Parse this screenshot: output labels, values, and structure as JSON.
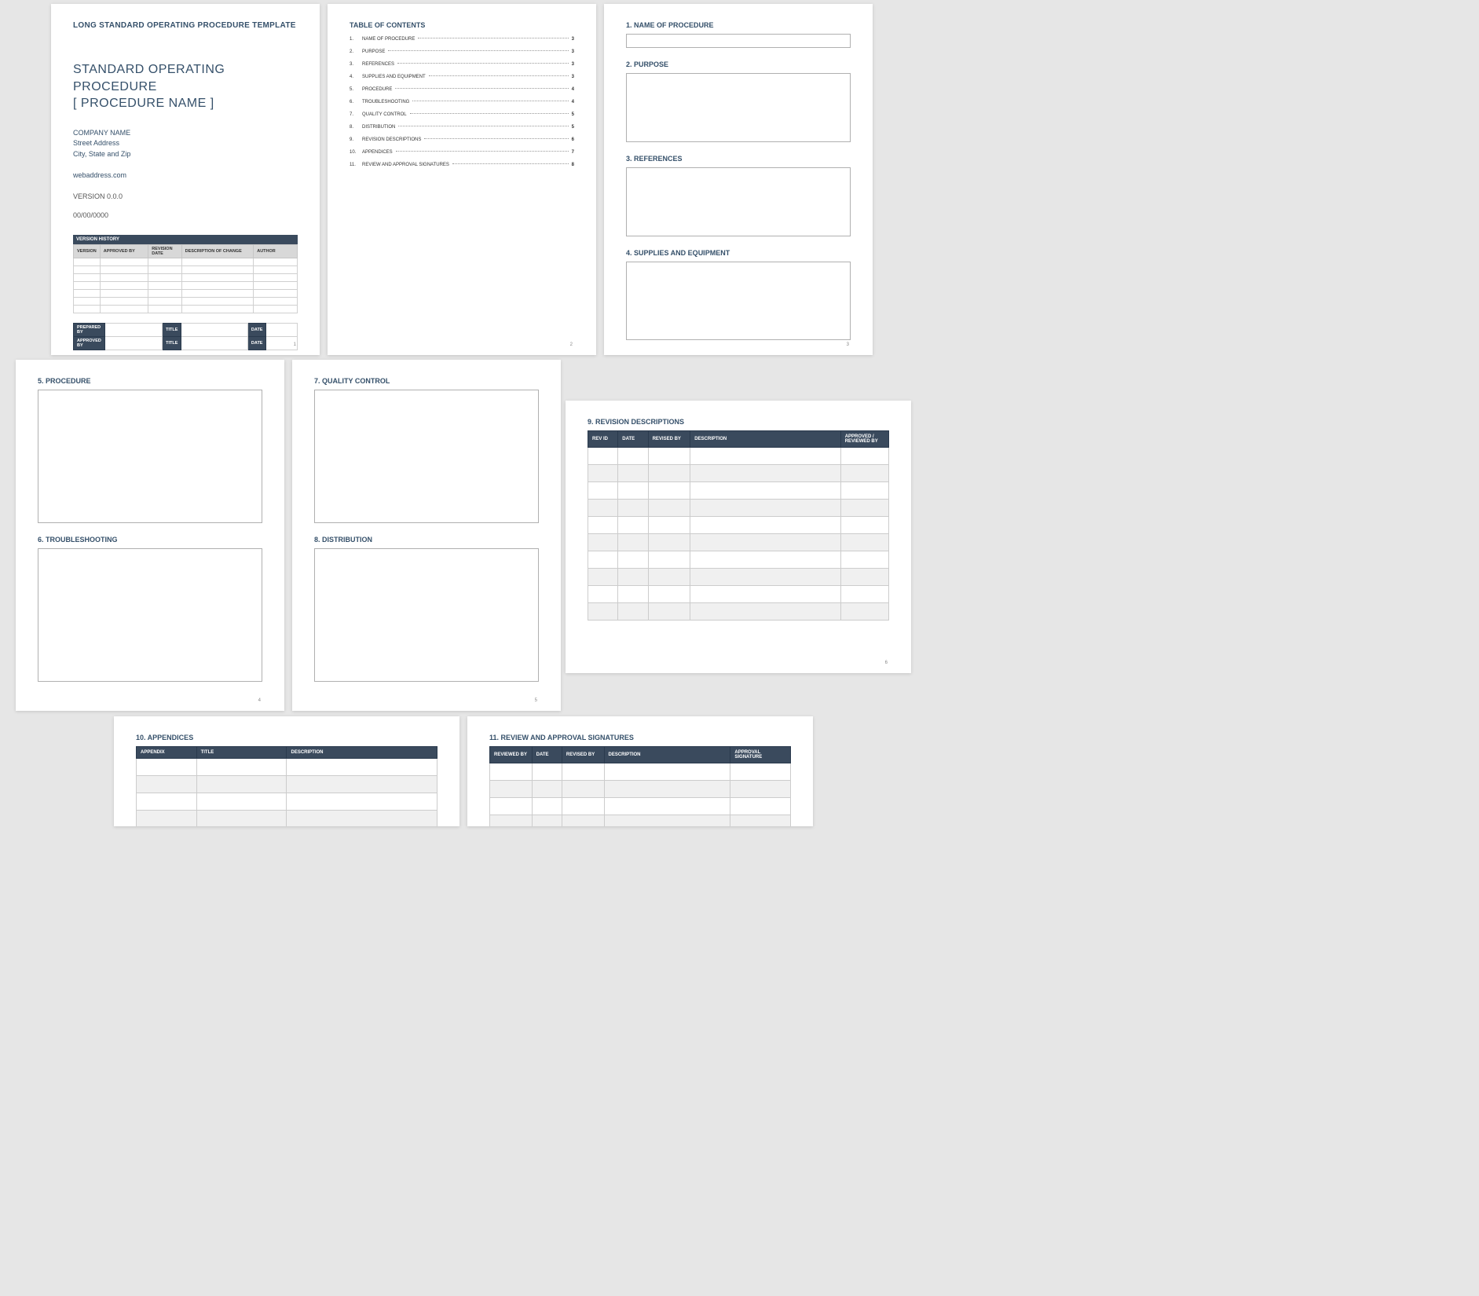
{
  "p1": {
    "template_title": "LONG STANDARD OPERATING PROCEDURE TEMPLATE",
    "main_title": "STANDARD OPERATING PROCEDURE",
    "subtitle": "[ PROCEDURE NAME ]",
    "company_name": "COMPANY NAME",
    "street": "Street Address",
    "city": "City, State and Zip",
    "web": "webaddress.com",
    "version": "VERSION 0.0.0",
    "date": "00/00/0000",
    "vh_title": "VERSION HISTORY",
    "vh_headers": [
      "VERSION",
      "APPROVED BY",
      "REVISION DATE",
      "DESCRIPTION OF CHANGE",
      "AUTHOR"
    ],
    "sig": {
      "prepared": "PREPARED BY",
      "approved": "APPROVED BY",
      "title": "TITLE",
      "date": "DATE"
    },
    "pagenum": "1"
  },
  "p2": {
    "toc_title": "TABLE OF CONTENTS",
    "items": [
      {
        "label": "NAME OF PROCEDURE",
        "page": "3"
      },
      {
        "label": "PURPOSE",
        "page": "3"
      },
      {
        "label": "REFERENCES",
        "page": "3"
      },
      {
        "label": "SUPPLIES AND EQUIPMENT",
        "page": "3"
      },
      {
        "label": "PROCEDURE",
        "page": "4"
      },
      {
        "label": "TROUBLESHOOTING",
        "page": "4"
      },
      {
        "label": "QUALITY CONTROL",
        "page": "5"
      },
      {
        "label": "DISTRIBUTION",
        "page": "5"
      },
      {
        "label": "REVISION DESCRIPTIONS",
        "page": "6"
      },
      {
        "label": "APPENDICES",
        "page": "7"
      },
      {
        "label": "REVIEW AND APPROVAL SIGNATURES",
        "page": "8"
      }
    ],
    "pagenum": "2"
  },
  "p3": {
    "s1": "1.  NAME OF PROCEDURE",
    "s2": "2.  PURPOSE",
    "s3": "3.  REFERENCES",
    "s4": "4.  SUPPLIES AND EQUIPMENT",
    "pagenum": "3"
  },
  "p4": {
    "s5": "5.  PROCEDURE",
    "s6": "6.  TROUBLESHOOTING",
    "pagenum": "4"
  },
  "p5": {
    "s7": "7.  QUALITY CONTROL",
    "s8": "8.  DISTRIBUTION",
    "pagenum": "5"
  },
  "p6": {
    "s9": "9.  REVISION DESCRIPTIONS",
    "headers": [
      "REV ID",
      "DATE",
      "REVISED BY",
      "DESCRIPTION",
      "APPROVED / REVIEWED BY"
    ],
    "pagenum": "6"
  },
  "p7": {
    "s10": "10.    APPENDICES",
    "headers": [
      "APPENDIX",
      "TITLE",
      "DESCRIPTION"
    ]
  },
  "p8": {
    "s11": "11.    REVIEW AND APPROVAL SIGNATURES",
    "headers": [
      "REVIEWED BY",
      "DATE",
      "REVISED BY",
      "DESCRIPTION",
      "APPROVAL SIGNATURE"
    ]
  }
}
